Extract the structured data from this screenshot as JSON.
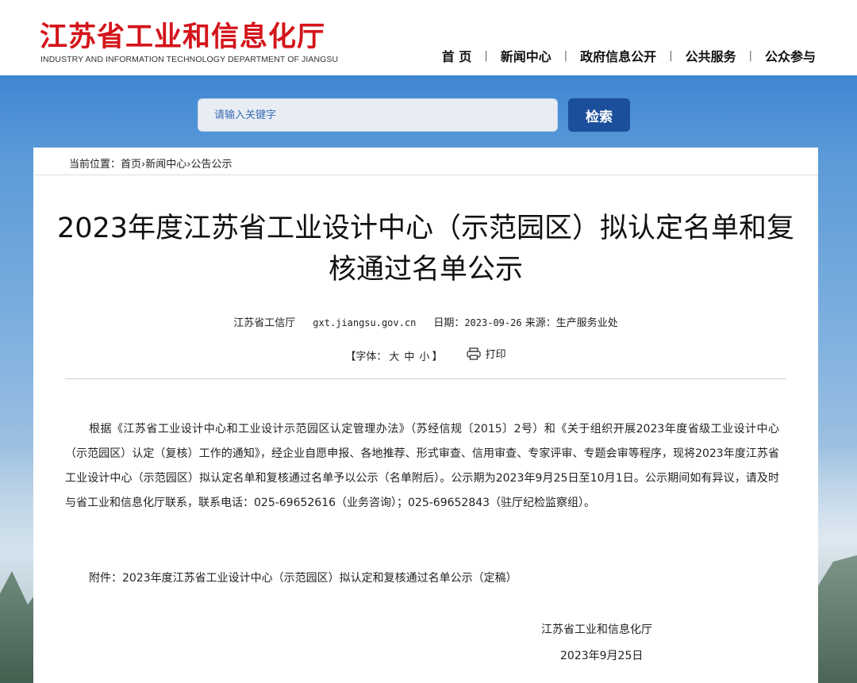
{
  "header": {
    "logo_cn": "江苏省工业和信息化厅",
    "logo_en": "INDUSTRY AND INFORMATION TECHNOLOGY DEPARTMENT OF JIANGSU",
    "brand_color": "#d4141b",
    "nav": [
      "首 页",
      "新闻中心",
      "政府信息公开",
      "公共服务",
      "公众参与"
    ],
    "nav_separator": "|"
  },
  "search": {
    "placeholder": "请输入关键字",
    "button_label": "检索"
  },
  "breadcrumb": {
    "prefix": "当前位置：",
    "items": [
      "首页",
      "新闻中心",
      "公告公示"
    ],
    "separator": "›"
  },
  "article": {
    "title": "2023年度江苏省工业设计中心（示范园区）拟认定名单和复核通过名单公示",
    "meta": {
      "publisher": "江苏省工信厅",
      "site": "gxt.jiangsu.gov.cn",
      "date_label": "日期：",
      "date": "2023-09-26",
      "source_label": "来源：",
      "source": "生产服务业处"
    },
    "font_size": {
      "label_open": "【字体：",
      "large": "大",
      "medium": "中",
      "small": "小",
      "label_close": "】"
    },
    "print_label": "打印",
    "body": "根据《江苏省工业设计中心和工业设计示范园区认定管理办法》（苏经信规〔2015〕2号）和《关于组织开展2023年度省级工业设计中心（示范园区）认定（复核）工作的通知》，经企业自愿申报、各地推荐、形式审查、信用审查、专家评审、专题会审等程序，现将2023年度江苏省工业设计中心（示范园区）拟认定名单和复核通过名单予以公示（名单附后）。公示期为2023年9月25日至10月1日。公示期间如有异议，请及时与省工业和信息化厅联系，联系电话：025-69652616（业务咨询）；025-69652843（驻厅纪检监察组）。",
    "attachment": "附件：2023年度江苏省工业设计中心（示范园区）拟认定和复核通过名单公示（定稿）",
    "sign_org": "江苏省工业和信息化厅",
    "sign_date": "2023年9月25日"
  }
}
